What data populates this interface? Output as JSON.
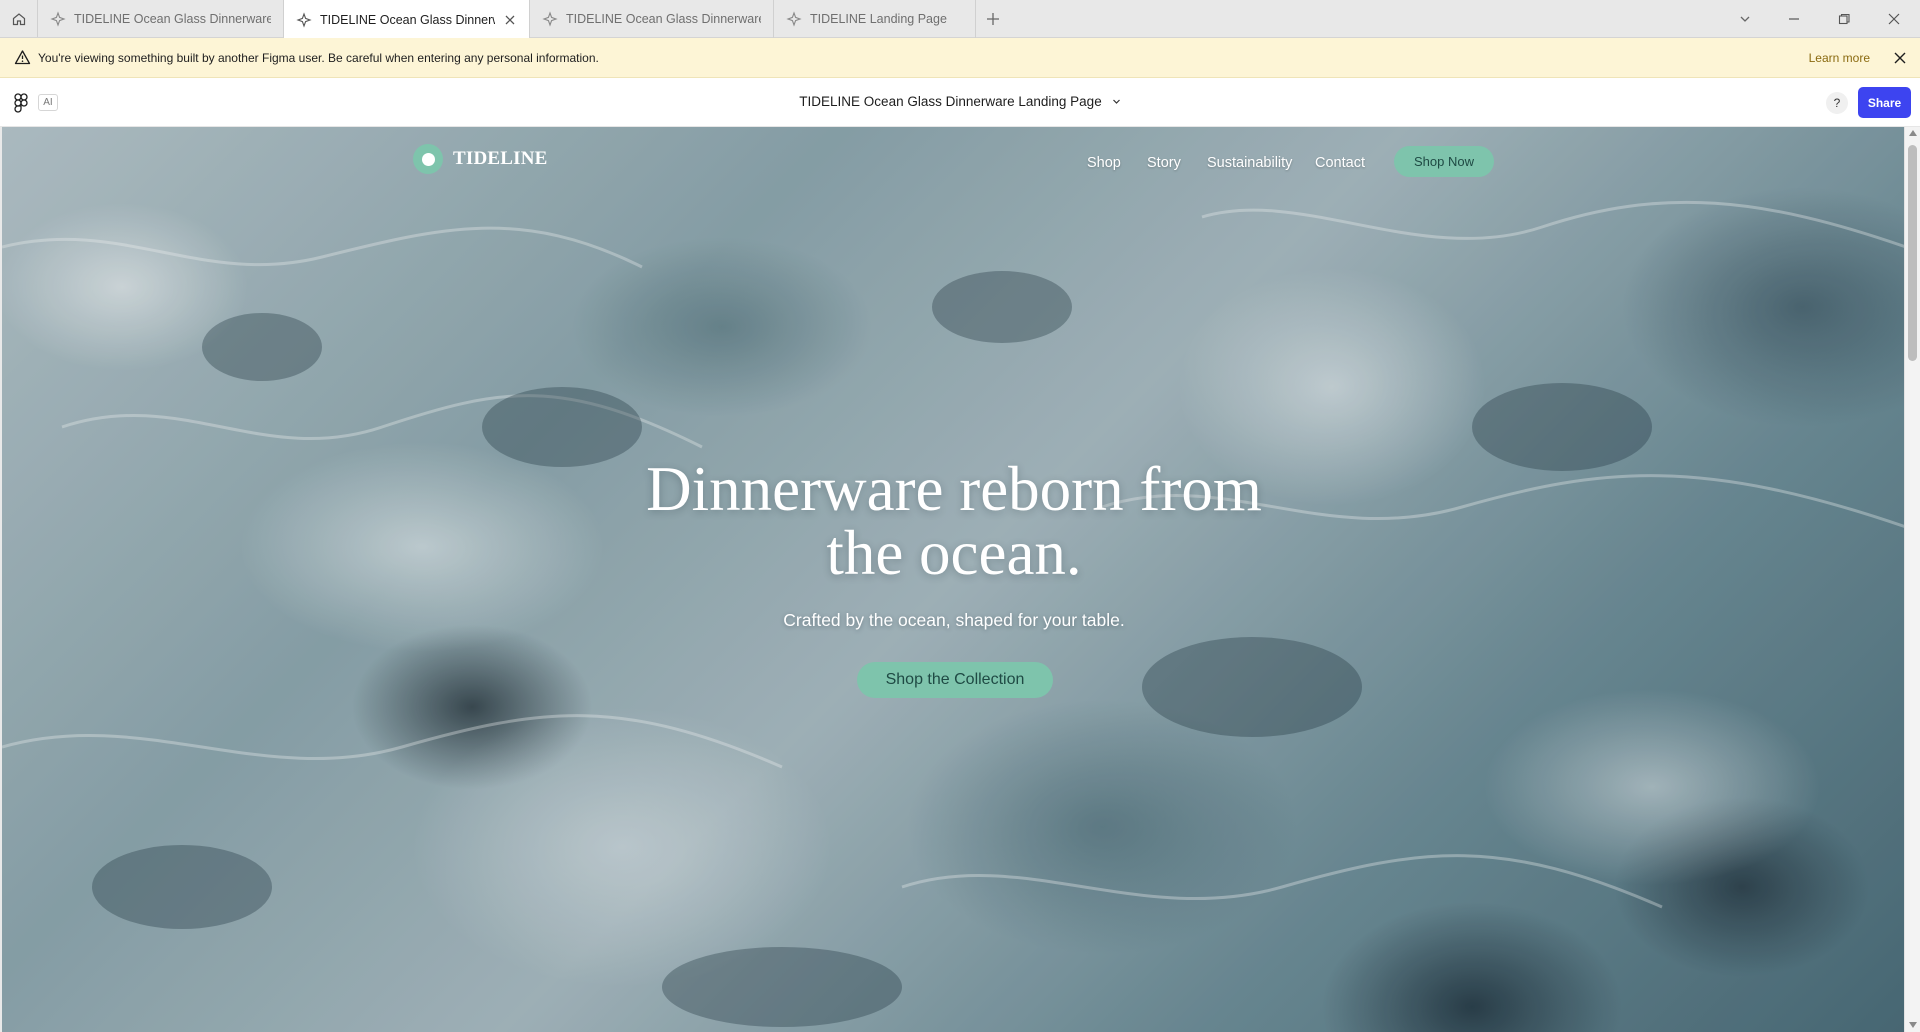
{
  "browser": {
    "tabs": [
      {
        "label": "TIDELINE Ocean Glass Dinnerware La",
        "active": false
      },
      {
        "label": "TIDELINE Ocean Glass Dinnerwa",
        "active": true
      },
      {
        "label": "TIDELINE Ocean Glass Dinnerware St",
        "active": false
      },
      {
        "label": "TIDELINE Landing Page",
        "active": false
      }
    ]
  },
  "banner": {
    "message": "You're viewing something built by another Figma user. Be careful when entering any personal information.",
    "learn_more": "Learn more"
  },
  "toolbar": {
    "ai_label": "AI",
    "file_title": "TIDELINE Ocean Glass Dinnerware Landing Page",
    "help_label": "?",
    "share_label": "Share"
  },
  "site": {
    "brand": "TIDELINE",
    "nav": [
      "Shop",
      "Story",
      "Sustainability",
      "Contact"
    ],
    "nav_cta": "Shop Now",
    "hero_title_line1": "Dinnerware reborn from",
    "hero_title_line2": "the ocean.",
    "hero_subtitle": "Crafted by the ocean, shaped for your table.",
    "hero_cta": "Shop the Collection"
  },
  "colors": {
    "accent": "#7ec4ac",
    "share_button": "#3d44f0",
    "banner_background": "#fdf5d6"
  },
  "icons": [
    "home-icon",
    "figma-file-icon",
    "close-icon",
    "plus-icon",
    "chevron-down-icon",
    "minimize-icon",
    "restore-icon",
    "warning-icon",
    "figma-logo-icon"
  ]
}
